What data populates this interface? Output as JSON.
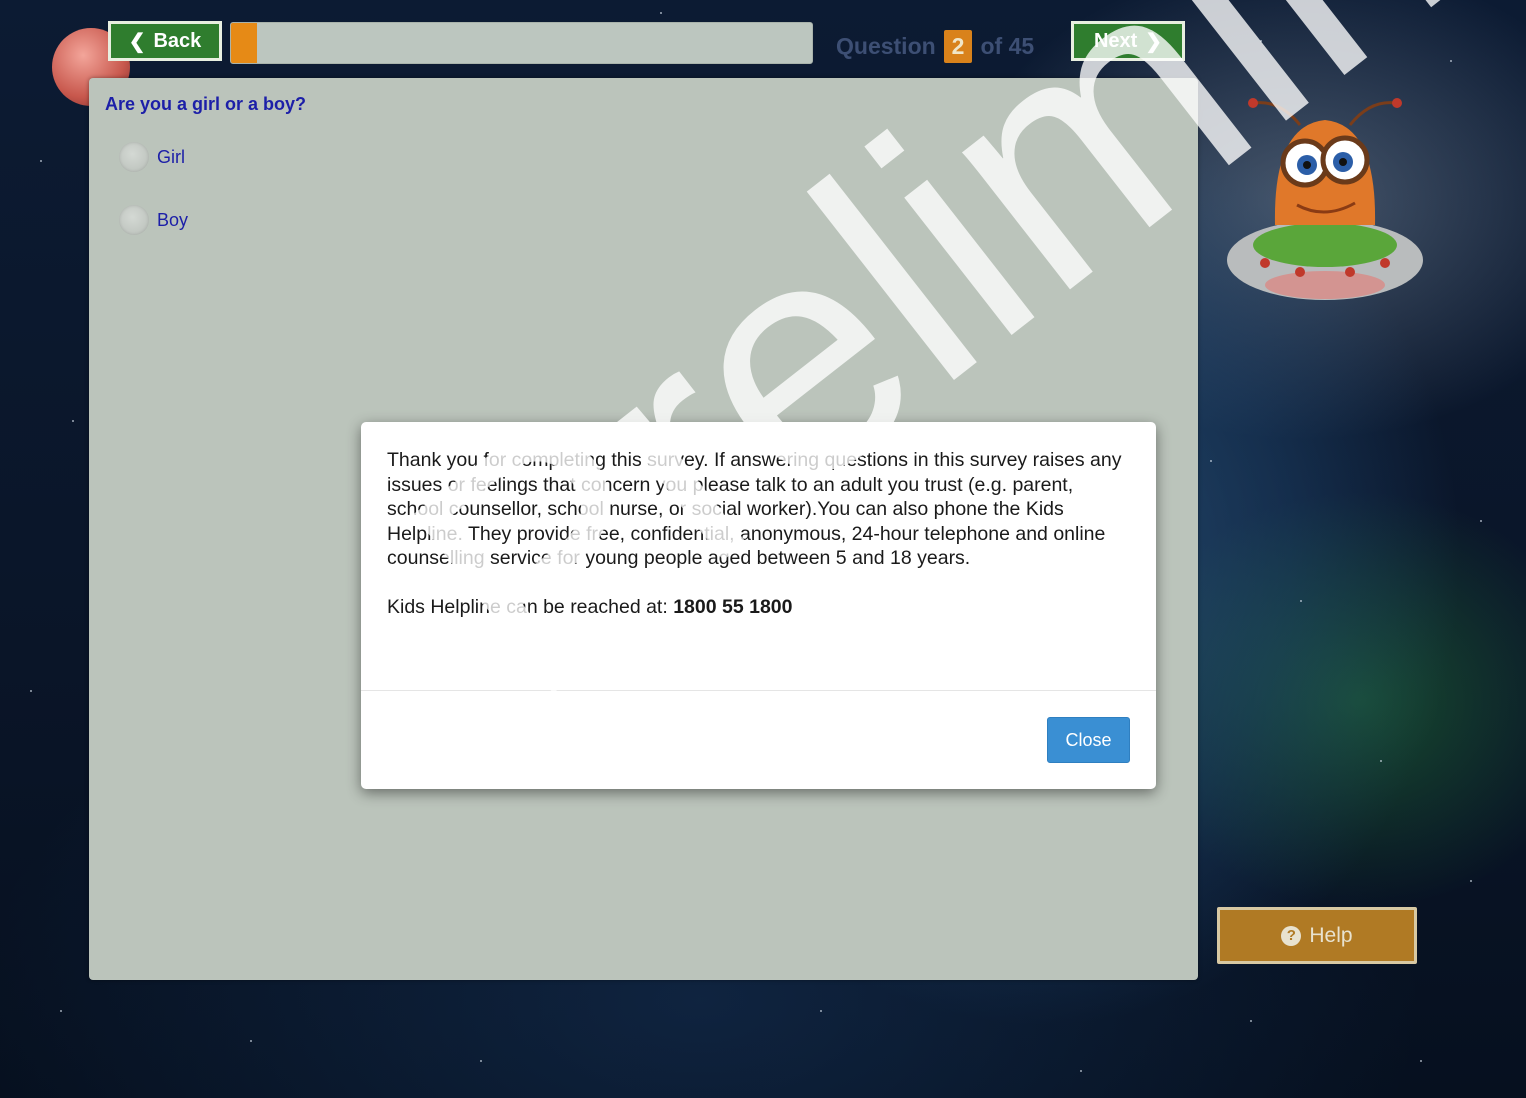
{
  "nav": {
    "back_label": "Back",
    "next_label": "Next",
    "progress_fraction": 0.044,
    "question_word": "Question",
    "question_current": "2",
    "question_of": "of 45"
  },
  "question": {
    "title": "Are you a girl or a boy?",
    "options": [
      "Girl",
      "Boy"
    ]
  },
  "help": {
    "label": "Help",
    "icon": "question-circle-icon"
  },
  "modal": {
    "paragraph": "Thank you for completing this survey. If answering questions in this survey raises any issues or feelings that concern you please talk to an adult you trust (e.g. parent, school counsellor, school nurse, or social worker).You can also phone the Kids Helpline. They provide free, confidential, anonymous, 24-hour telephone and online counselling service for young people aged between 5 and 18 years.",
    "helpline_prefix": "Kids Helpline can be reached at:",
    "helpline_number": "1800 55 1800",
    "close_label": "Close"
  },
  "watermark": "Preliminary",
  "colors": {
    "nav_green": "#2f7d2e",
    "progress_orange": "#e68a16",
    "question_blue": "#1c1fa8",
    "help_orange": "#b07a24",
    "close_blue": "#3a8fd3"
  }
}
